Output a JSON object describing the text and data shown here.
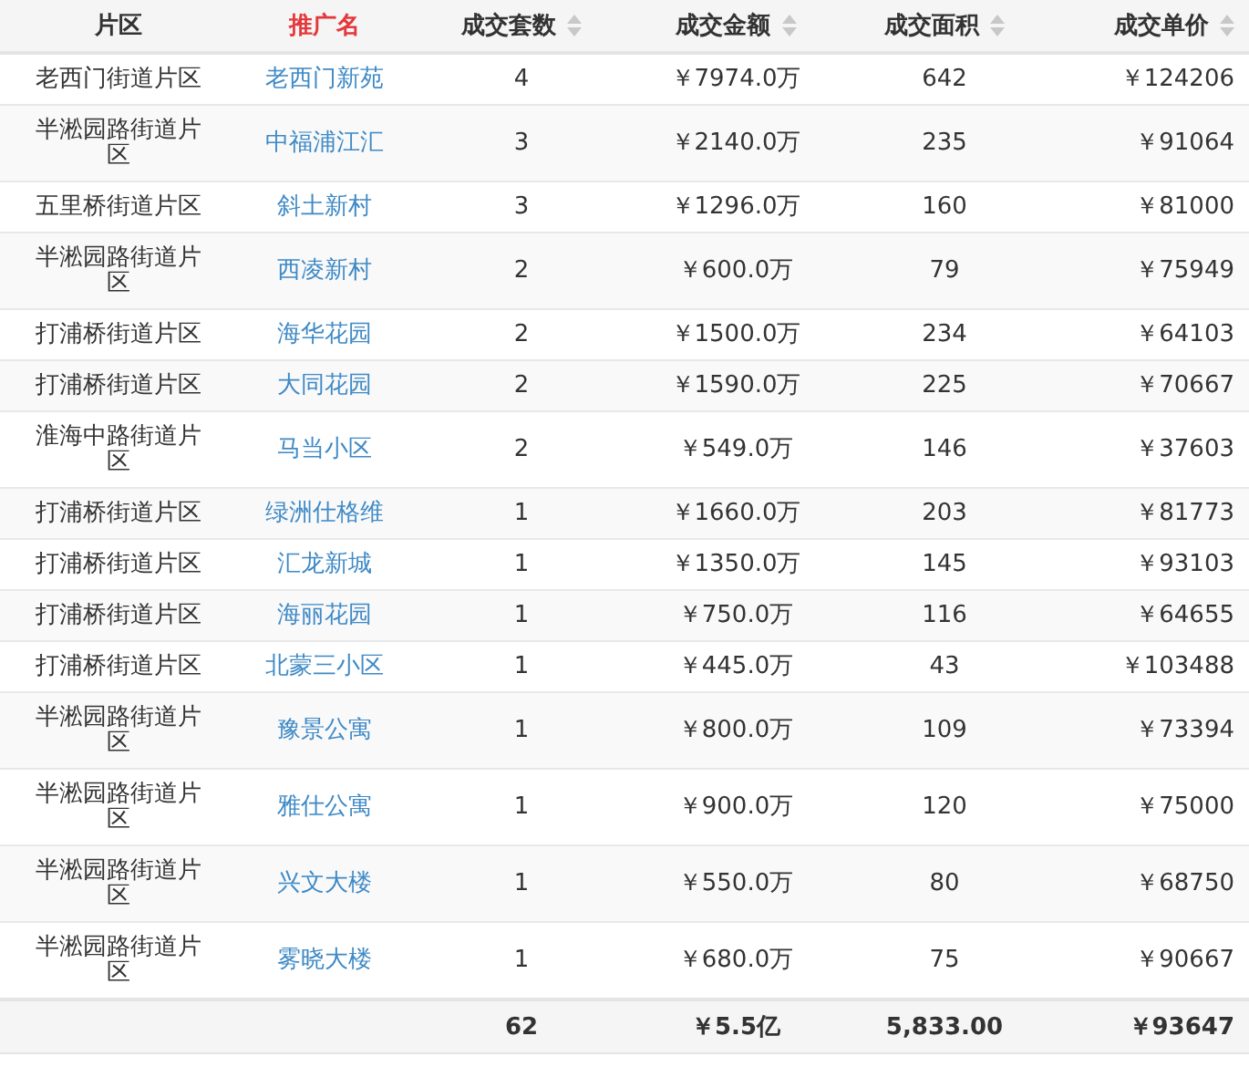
{
  "table": {
    "columns": [
      {
        "label": "片区",
        "sortable": false,
        "selected": false
      },
      {
        "label": "推广名",
        "sortable": false,
        "selected": true
      },
      {
        "label": "成交套数",
        "sortable": true,
        "selected": false
      },
      {
        "label": "成交金额",
        "sortable": true,
        "selected": false
      },
      {
        "label": "成交面积",
        "sortable": true,
        "selected": false
      },
      {
        "label": "成交单价",
        "sortable": true,
        "selected": false
      }
    ],
    "rows": [
      {
        "district": "老西门街道片区",
        "name": "老西门新苑",
        "count": "4",
        "amount": "￥7974.0万",
        "area": "642",
        "price": "￥124206"
      },
      {
        "district": "半淞园路街道片区",
        "name": "中福浦江汇",
        "count": "3",
        "amount": "￥2140.0万",
        "area": "235",
        "price": "￥91064"
      },
      {
        "district": "五里桥街道片区",
        "name": "斜土新村",
        "count": "3",
        "amount": "￥1296.0万",
        "area": "160",
        "price": "￥81000"
      },
      {
        "district": "半淞园路街道片区",
        "name": "西凌新村",
        "count": "2",
        "amount": "￥600.0万",
        "area": "79",
        "price": "￥75949"
      },
      {
        "district": "打浦桥街道片区",
        "name": "海华花园",
        "count": "2",
        "amount": "￥1500.0万",
        "area": "234",
        "price": "￥64103"
      },
      {
        "district": "打浦桥街道片区",
        "name": "大同花园",
        "count": "2",
        "amount": "￥1590.0万",
        "area": "225",
        "price": "￥70667"
      },
      {
        "district": "淮海中路街道片区",
        "name": "马当小区",
        "count": "2",
        "amount": "￥549.0万",
        "area": "146",
        "price": "￥37603"
      },
      {
        "district": "打浦桥街道片区",
        "name": "绿洲仕格维",
        "count": "1",
        "amount": "￥1660.0万",
        "area": "203",
        "price": "￥81773"
      },
      {
        "district": "打浦桥街道片区",
        "name": "汇龙新城",
        "count": "1",
        "amount": "￥1350.0万",
        "area": "145",
        "price": "￥93103"
      },
      {
        "district": "打浦桥街道片区",
        "name": "海丽花园",
        "count": "1",
        "amount": "￥750.0万",
        "area": "116",
        "price": "￥64655"
      },
      {
        "district": "打浦桥街道片区",
        "name": "北蒙三小区",
        "count": "1",
        "amount": "￥445.0万",
        "area": "43",
        "price": "￥103488"
      },
      {
        "district": "半淞园路街道片区",
        "name": "豫景公寓",
        "count": "1",
        "amount": "￥800.0万",
        "area": "109",
        "price": "￥73394"
      },
      {
        "district": "半淞园路街道片区",
        "name": "雅仕公寓",
        "count": "1",
        "amount": "￥900.0万",
        "area": "120",
        "price": "￥75000"
      },
      {
        "district": "半淞园路街道片区",
        "name": "兴文大楼",
        "count": "1",
        "amount": "￥550.0万",
        "area": "80",
        "price": "￥68750"
      },
      {
        "district": "半淞园路街道片区",
        "name": "雾晓大楼",
        "count": "1",
        "amount": "￥680.0万",
        "area": "75",
        "price": "￥90667"
      }
    ],
    "footer": {
      "count": "62",
      "amount": "￥5.5亿",
      "area": "5,833.00",
      "price": "￥93647"
    }
  }
}
